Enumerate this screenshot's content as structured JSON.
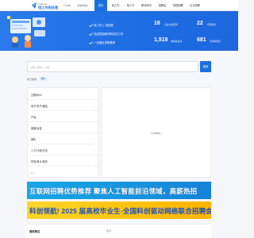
{
  "header": {
    "logo_site": "zyttp.net",
    "logo_brand": "找工作到还是",
    "location": "广州市",
    "location_switch": "[切换城市]",
    "nav": [
      "首页",
      "找工作",
      "找人才",
      "职场资讯",
      "招聘会",
      "校园招聘",
      "企业招聘"
    ]
  },
  "banner": {
    "features": [
      "找工作上 找还是",
      "找还是高薪好职位好工作",
      "一站满足求职需求"
    ],
    "stats": [
      {
        "value": "16",
        "label": "企业在线招聘"
      },
      {
        "value": "22",
        "label": "招聘职位"
      },
      {
        "value": "1,518",
        "label": "求职者在线"
      },
      {
        "value": "681",
        "label": "份求职简历"
      }
    ]
  },
  "search": {
    "placeholder": "请输入职位、公司",
    "button": "搜索"
  },
  "hot": {
    "label": "热门搜索：",
    "tags": [
      "销售"
    ]
  },
  "categories": {
    "items": [
      "互联网/AI",
      "电子/电气/通信",
      "产品",
      "客服/运营",
      "销售",
      "人力/行政/法务",
      "财务/审计/税务"
    ],
    "pager": "1/4"
  },
  "content": {
    "loading": "Loading..."
  },
  "ads": [
    {
      "text": "互联网招聘优势推荐 聚焦人工智能前沿领域，高薪热招"
    },
    {
      "text": "科创领航! 2025 届高校毕业生·全国科创驱动网络联合招聘会启动"
    }
  ],
  "bottom": {
    "title": "最新职位",
    "more": "更多"
  },
  "colors": {
    "primary": "#1a6fe0",
    "banner": "#2073e6",
    "ad1": "#1a9ae0",
    "ad2": "#ffc814"
  }
}
